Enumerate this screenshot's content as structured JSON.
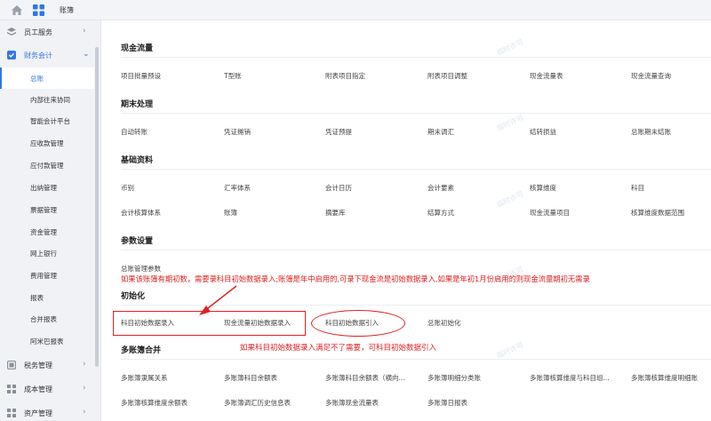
{
  "topbar": {
    "home_icon": "home-icon",
    "grid_icon": "grid-icon",
    "breadcrumb": "账簿"
  },
  "sidebar": {
    "top_items": [
      {
        "label": "员工服务",
        "icon": "employee-icon",
        "expanded": false
      },
      {
        "label": "财务会计",
        "icon": "finance-icon",
        "expanded": true
      }
    ],
    "sub_items": [
      "总账",
      "内部往来协同",
      "智能会计平台",
      "应收款管理",
      "应付款管理",
      "出纳管理",
      "票据管理",
      "资金管理",
      "网上银行",
      "费用管理",
      "报表",
      "合并报表",
      "阿米巴报表"
    ],
    "selected_sub": "总账",
    "bottom_items": [
      {
        "label": "税务管理",
        "icon": "tax-icon"
      },
      {
        "label": "成本管理",
        "icon": "cost-icon"
      },
      {
        "label": "资产管理",
        "icon": "asset-icon"
      }
    ]
  },
  "main": {
    "watermark": "临时许可",
    "sections": [
      {
        "title": "现金流量",
        "rows": [
          [
            "项目批量预设",
            "T型账",
            "附表项目指定",
            "附表项目调整",
            "现金流量表",
            "现金流量查询"
          ]
        ]
      },
      {
        "title": "期末处理",
        "rows": [
          [
            "自动转账",
            "凭证摊销",
            "凭证预提",
            "期末调汇",
            "结转损益",
            "总账期末结账"
          ]
        ]
      },
      {
        "title": "基础资料",
        "rows": [
          [
            "币别",
            "汇率体系",
            "会计日历",
            "会计要素",
            "核算维度",
            "科目"
          ],
          [
            "会计核算体系",
            "账簿",
            "摘要库",
            "结算方式",
            "现金流量项目",
            "核算维度数据范围"
          ]
        ]
      },
      {
        "title": "参数设置",
        "rows": [
          [
            "总账管理参数"
          ]
        ]
      },
      {
        "title": "初始化",
        "rows": [
          [
            "科目初始数据录入",
            "现金流量初始数据录入",
            "科目初始数据引入",
            "总账初始化"
          ]
        ]
      },
      {
        "title": "多账簿合并",
        "rows": [
          [
            "多账簿隶属关系",
            "多账簿科目余额表",
            "多账簿科目余额表（横向...",
            "多账簿明细分类账",
            "多账簿核算维度与科目组...",
            "多账簿核算维度明细账"
          ],
          [
            "多账簿核算维度余额表",
            "多账簿调汇历史信息表",
            "多账簿现金流量表",
            "多账簿日报表"
          ]
        ]
      }
    ]
  },
  "annotations": {
    "note1": "如果该账簿有期初数，需要录科目初始数据录入;账簿是年中启用的,可录下现金流是初始数据录入,如果是年初1月份启用的则现金流量期初无需录",
    "note2": "如果科目初始数据录入满足不了需要，可科目初始数据引入",
    "color": "#e02020"
  },
  "colors": {
    "accent": "#3276e6",
    "sidebar_bg": "#f1f2f5"
  }
}
